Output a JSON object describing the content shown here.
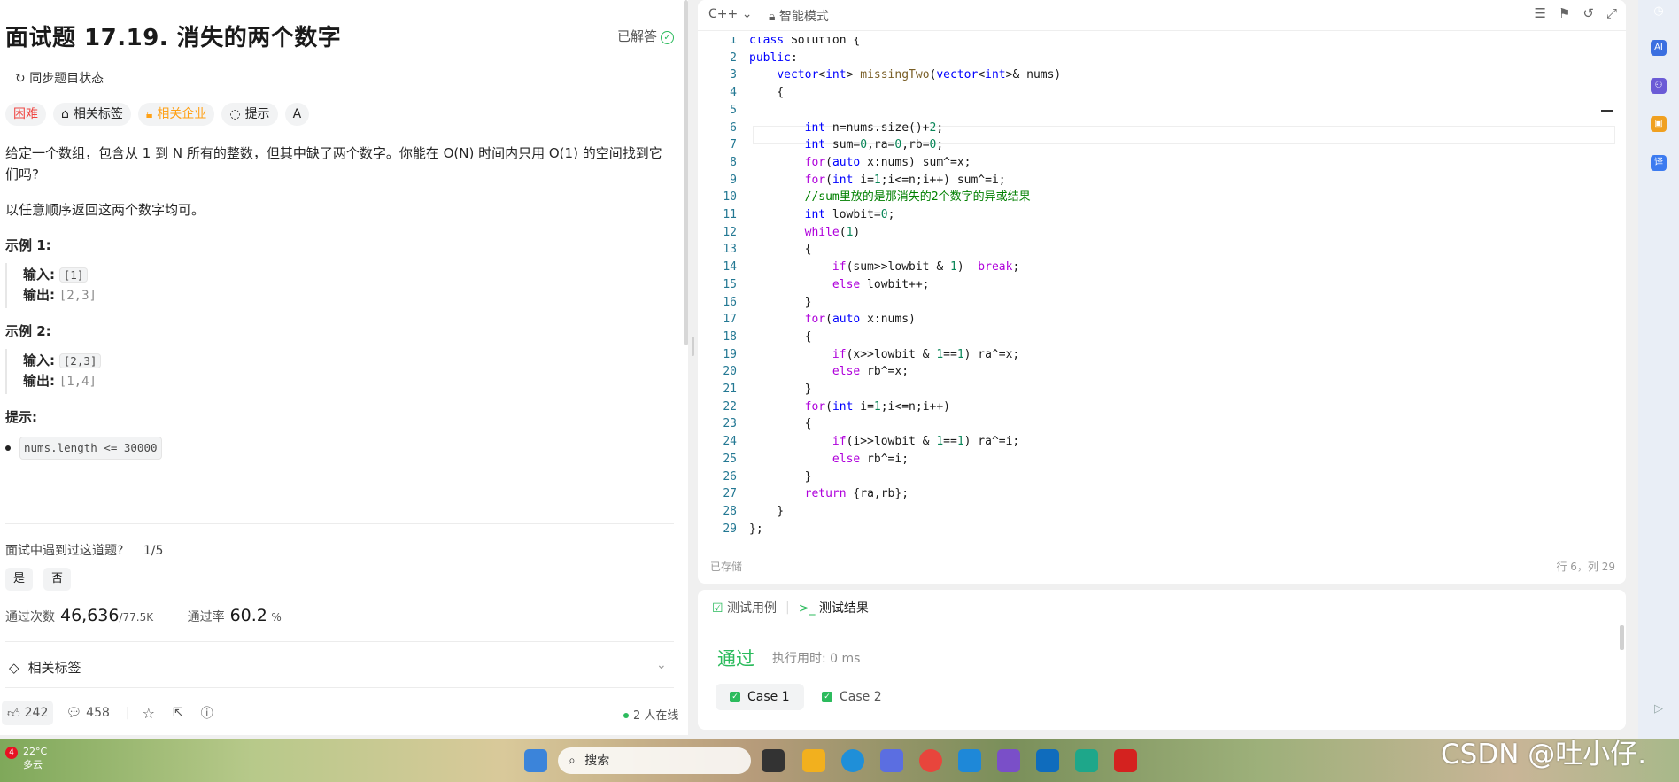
{
  "problem": {
    "title": "面试题 17.19. 消失的两个数字",
    "solved_label": "已解答",
    "sync_label": "同步题目状态",
    "tags": {
      "difficulty": "困难",
      "related_tags": "相关标签",
      "related_companies": "相关企业",
      "hint": "提示"
    },
    "desc_p1": "给定一个数组，包含从 1 到 N 所有的整数，但其中缺了两个数字。你能在 O(N) 时间内只用 O(1) 的空间找到它们吗?",
    "desc_p2": "以任意顺序返回这两个数字均可。",
    "example1_title": "示例 1:",
    "example1_in_label": "输入:",
    "example1_in": "[1]",
    "example1_out_label": "输出:",
    "example1_out": "[2,3]",
    "example2_title": "示例 2:",
    "example2_in_label": "输入:",
    "example2_in": "[2,3]",
    "example2_out_label": "输出:",
    "example2_out": "[1,4]",
    "hints_title": "提示:",
    "constraint": "nums.length <= 30000",
    "met_question": "面试中遇到过这道题?",
    "met_count": "1/5",
    "yes": "是",
    "no": "否",
    "accept_label": "通过次数",
    "accept_value": "46,636",
    "accept_total": "/77.5K",
    "rate_label": "通过率",
    "rate_value": "60.2",
    "rate_unit": "%",
    "related_tags_section": "相关标签",
    "likes": "242",
    "comments": "458",
    "online": "2 人在线"
  },
  "editor": {
    "language": "C++",
    "mode": "智能模式",
    "saved": "已存储",
    "cursor": "行 6，列 29"
  },
  "tests": {
    "tab_cases": "测试用例",
    "tab_results": "测试结果",
    "status": "通过",
    "runtime": "执行用时: 0 ms",
    "case1": "Case 1",
    "case2": "Case 2"
  },
  "taskbar": {
    "temp": "22°C",
    "weather": "多云",
    "badge": "4",
    "search_placeholder": "搜索"
  },
  "watermark": "CSDN @吐小仔.",
  "code_lines": [
    "class Solution {",
    "public:",
    "    vector<int> missingTwo(vector<int>& nums)",
    "    {",
    "",
    "        int n=nums.size()+2;",
    "        int sum=0,ra=0,rb=0;",
    "        for(auto x:nums) sum^=x;",
    "        for(int i=1;i<=n;i++) sum^=i;",
    "        //sum里放的是那消失的2个数字的异或结果",
    "        int lowbit=0;",
    "        while(1)",
    "        {",
    "            if(sum>>lowbit & 1)  break;",
    "            else lowbit++;",
    "        }",
    "        for(auto x:nums)",
    "        {",
    "            if(x>>lowbit & 1==1) ra^=x;",
    "            else rb^=x;",
    "        }",
    "        for(int i=1;i<=n;i++)",
    "        {",
    "            if(i>>lowbit & 1==1) ra^=i;",
    "            else rb^=i;",
    "        }",
    "        return {ra,rb};",
    "    }",
    "};"
  ]
}
